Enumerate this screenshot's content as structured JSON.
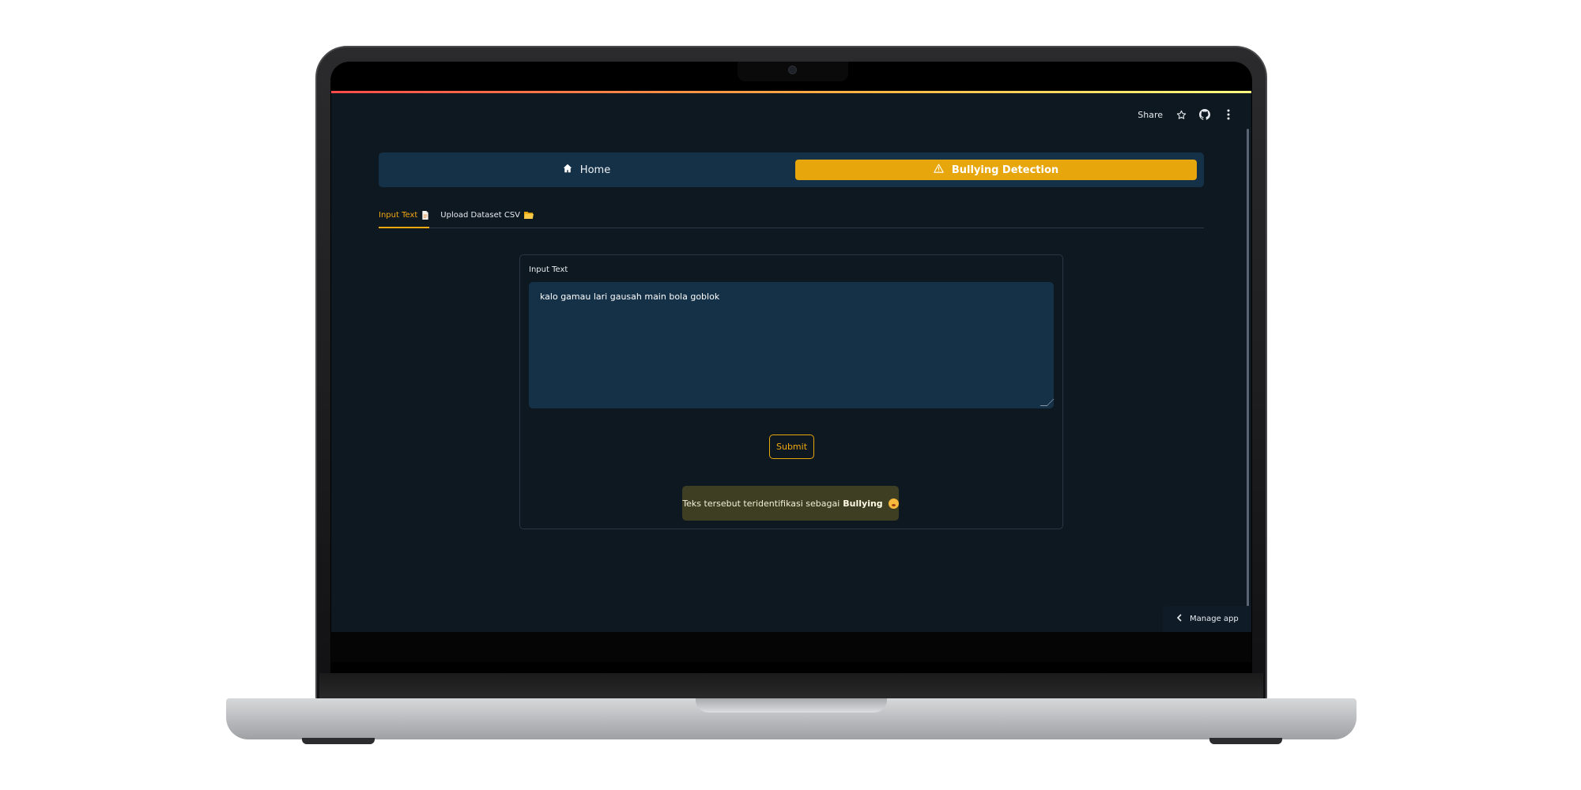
{
  "toolbar": {
    "share_label": "Share",
    "icons": [
      "star-icon",
      "github-icon",
      "more-vertical-icon"
    ]
  },
  "nav": {
    "items": [
      {
        "label": "Home",
        "icon": "home-icon",
        "active": false
      },
      {
        "label": "Bullying Detection",
        "icon": "warning-icon",
        "active": true
      }
    ],
    "accent_color": "#e8a60d",
    "background_color": "#153148"
  },
  "tabs": [
    {
      "label": "Input Text",
      "icon": "page-emoji",
      "active": true
    },
    {
      "label": "Upload Dataset CSV",
      "icon": "folder-emoji",
      "active": false
    }
  ],
  "form": {
    "label": "Input Text",
    "value": "kalo gamau lari gausah main bola goblok",
    "submit_label": "Submit"
  },
  "result": {
    "prefix": "Teks tersebut teridentifikasi sebagai",
    "label": "Bullying",
    "icon": "frowning-face-emoji",
    "color": "#3e3f22"
  },
  "manage_app": {
    "label": "Manage app"
  },
  "colors": {
    "app_background": "#0e1821",
    "header_gradient": [
      "#ff4b4b",
      "#fdb843",
      "#fffd80"
    ]
  }
}
